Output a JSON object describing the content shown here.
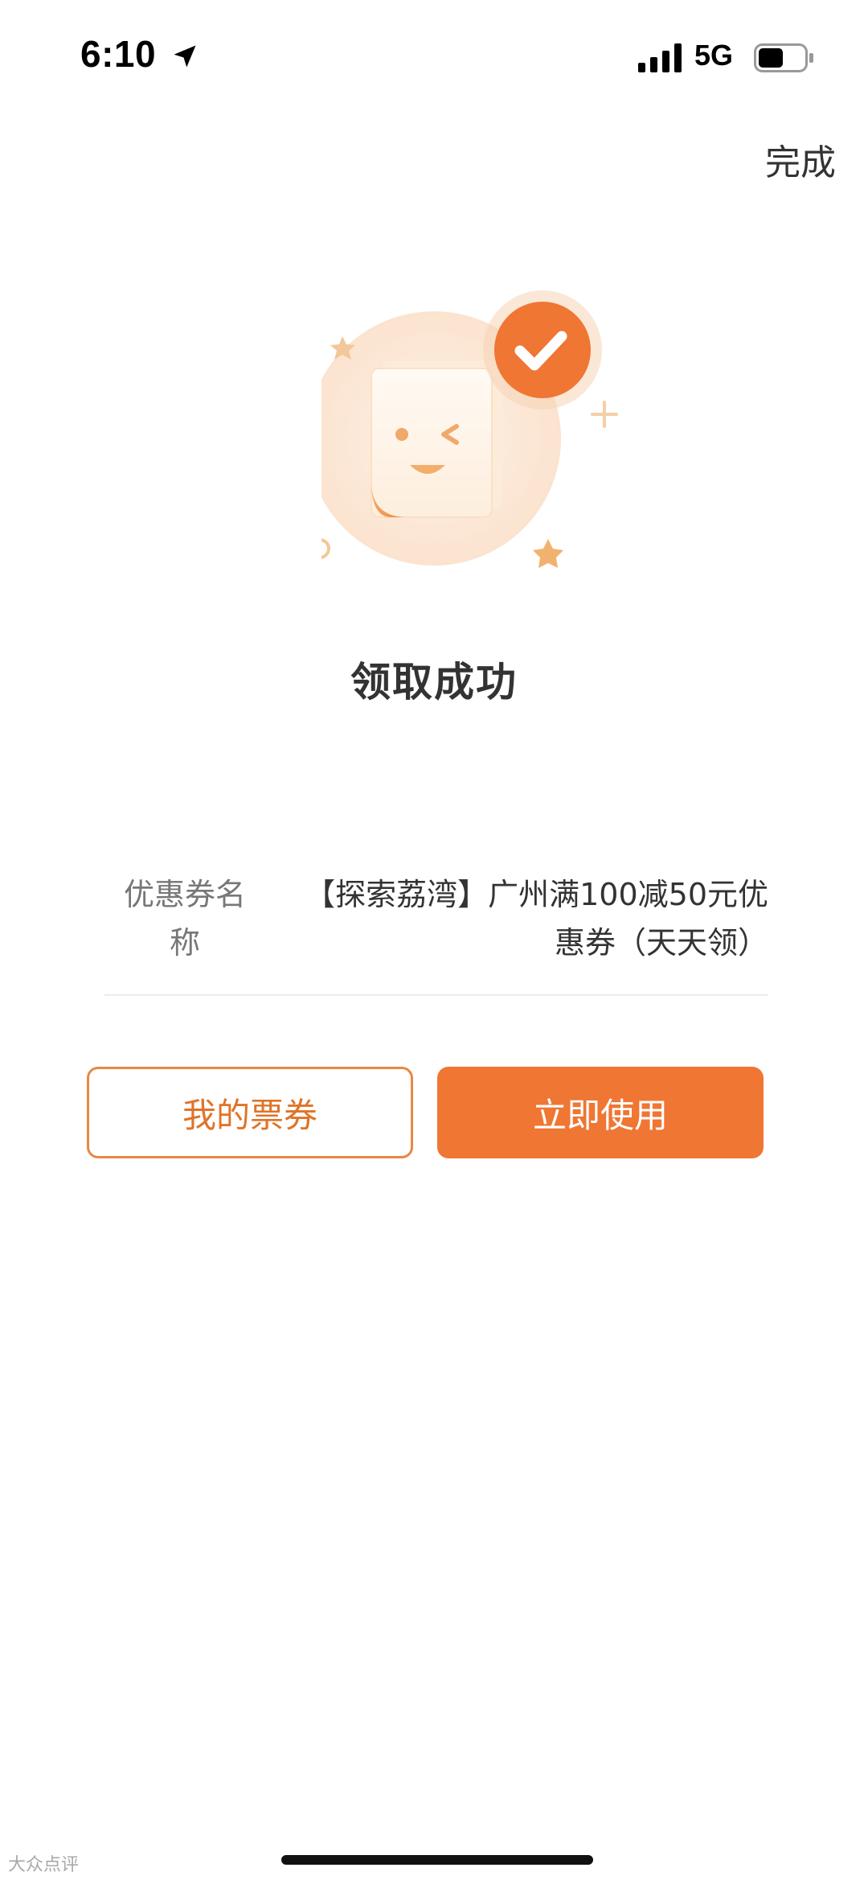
{
  "status_bar": {
    "time": "6:10",
    "network": "5G",
    "icons": [
      "location-arrow-icon",
      "signal-bars-icon",
      "battery-icon"
    ]
  },
  "header": {
    "done_label": "完成"
  },
  "illustration": {
    "icon": "coupon-success-icon",
    "accent_color": "#ef7633"
  },
  "title": "领取成功",
  "coupon": {
    "label": "优惠券名称",
    "value": "【探索荔湾】广州满100减50元优惠券（天天领）"
  },
  "buttons": {
    "my_tickets": "我的票券",
    "use_now": "立即使用"
  },
  "watermark": "大众点评",
  "colors": {
    "primary": "#ef7633",
    "outline": "#e88843",
    "text": "#333333",
    "muted": "#777777"
  }
}
